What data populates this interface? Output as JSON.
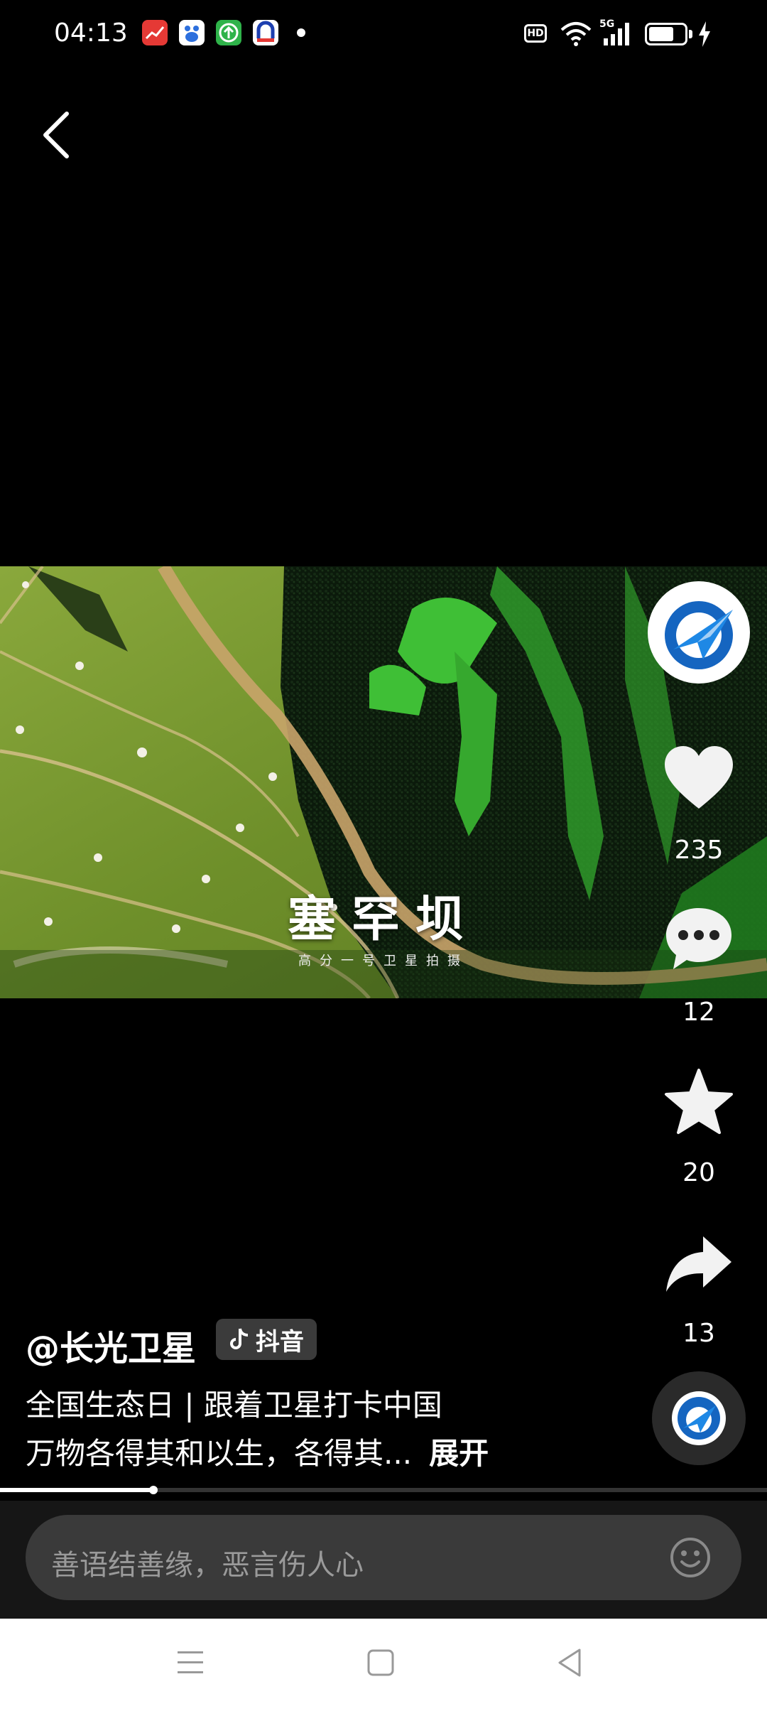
{
  "status_bar": {
    "time": "04:13",
    "network": "5G",
    "hd": "HD"
  },
  "video": {
    "title": "塞罕坝",
    "caption": "高分一号卫星拍摄"
  },
  "rail": {
    "likes": "235",
    "comments": "12",
    "favorites": "20",
    "shares": "13"
  },
  "author": {
    "handle": "@长光卫星",
    "platform": "抖音"
  },
  "description": {
    "line1": "全国生态日 | 跟着卫星打卡中国",
    "line2": "万物各得其和以生，各得其...",
    "expand": "展开"
  },
  "progress": {
    "fraction": 0.2
  },
  "comment": {
    "placeholder": "善语结善缘，恶言伤人心"
  },
  "icons": {
    "back": "back-arrow-icon",
    "like": "heart-icon",
    "comment": "comment-bubble-icon",
    "favorite": "star-icon",
    "share": "share-arrow-icon",
    "emoji": "emoji-icon",
    "nav_menu": "menu-icon",
    "nav_home": "home-square-icon",
    "nav_back": "triangle-back-icon"
  },
  "colors": {
    "background": "#000000",
    "video_grass": "#7a9a30",
    "video_forest": "#0c1f0c",
    "bright_green": "#43c23a",
    "comment_bar": "#3a3a3a"
  }
}
